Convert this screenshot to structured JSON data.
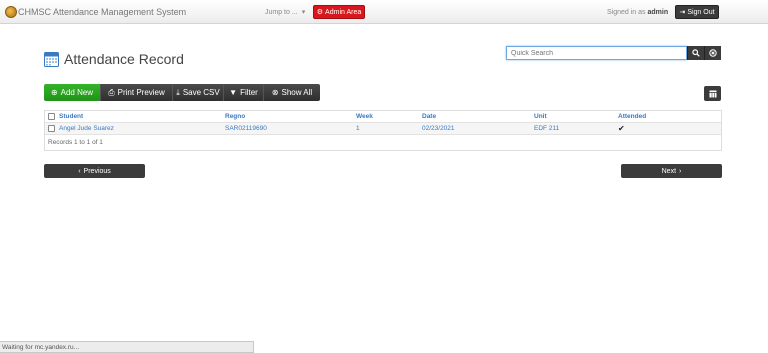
{
  "navbar": {
    "app_title": "CHMSC Attendance Management System",
    "jump_label": "Jump to ...",
    "admin_label": "Admin Area",
    "signed_prefix": "Signed in as",
    "signed_user": "admin",
    "signout_label": "Sign Out"
  },
  "page": {
    "title": "Attendance Record"
  },
  "search": {
    "placeholder": "Quick Search",
    "value": ""
  },
  "toolbar": {
    "add_new": "Add New",
    "print_preview": "Print Preview",
    "save_csv": "Save CSV",
    "filter": "Filter",
    "show_all": "Show All"
  },
  "grid": {
    "columns": [
      "Student",
      "Regno",
      "Week",
      "Date",
      "Unit",
      "Attended"
    ],
    "rows": [
      {
        "student": "Angel Jude Suarez",
        "regno": "SAR02119690",
        "week": "1",
        "date": "02/23/2021",
        "unit": "EDF 211",
        "attended": "✔"
      }
    ],
    "footer": "Records 1 to 1 of 1"
  },
  "pager": {
    "previous": "Previous",
    "next": "Next"
  },
  "status_bar": {
    "text": "Waiting for mc.yandex.ru..."
  },
  "icons": {
    "brand": "logo-icon",
    "admin": "gear-icon",
    "signout": "logout-icon",
    "search": "search-icon",
    "clear": "clear-icon",
    "add": "plus-circle-icon",
    "print": "print-icon",
    "csv": "download-icon",
    "filter": "filter-icon",
    "show_all": "circle-x-icon",
    "columns": "columns-icon",
    "calendar": "calendar-icon"
  },
  "colors": {
    "admin_red": "#d9181e",
    "add_green": "#27a31e",
    "link_blue": "#3a79c4",
    "dark_button": "#3b3b3b"
  }
}
